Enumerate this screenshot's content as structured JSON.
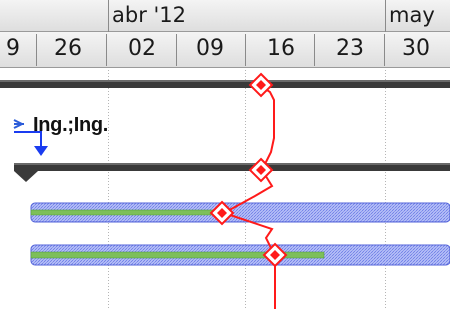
{
  "timescale": {
    "months": [
      {
        "label": "abr '12"
      },
      {
        "label": "may"
      }
    ],
    "weeks": [
      "9",
      "26",
      "02",
      "09",
      "16",
      "23",
      "30"
    ]
  },
  "task_label": "Ing.;Ing.",
  "colors": {
    "summary_bar": "#3a3a3a",
    "task_bar_hatch": "#6f7fe6",
    "progress": "#7dbf5a",
    "progress_line": "#ff1a1a",
    "dependency_arrow": "#1a3cf0"
  }
}
